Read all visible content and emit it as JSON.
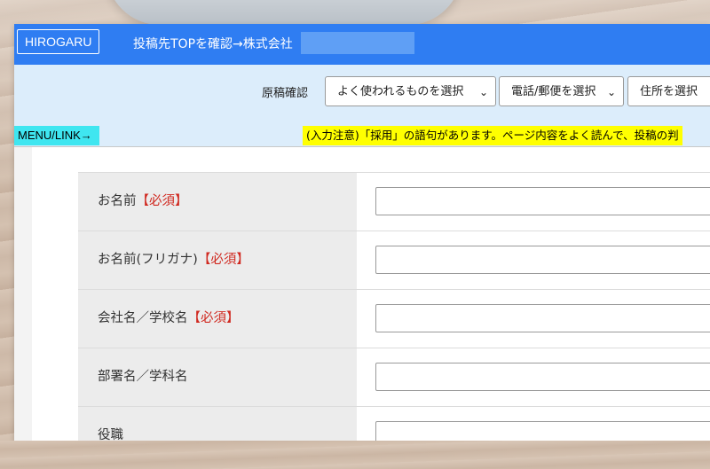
{
  "header": {
    "logo": "HIROGARU",
    "title": "投稿先TOPを確認→株式会社"
  },
  "toolbar": {
    "draft_check_label": "原稿確認",
    "select_common": "よく使われるものを選択",
    "select_phone_mail": "電話/郵便を選択",
    "select_address": "住所を選択"
  },
  "menu_link": "MENU/LINK→",
  "warning": "(入力注意)「採用」の語句があります。ページ内容をよく読んで、投稿の判",
  "form": {
    "required_mark": "【必須】",
    "rows": [
      {
        "label": "お名前",
        "required": "【必須】"
      },
      {
        "label": "お名前(フリガナ)",
        "required": "【必須】"
      },
      {
        "label": "会社名／学校名",
        "required": "【必須】"
      },
      {
        "label": "部署名／学科名",
        "required": ""
      },
      {
        "label": "役職",
        "required": ""
      }
    ]
  }
}
